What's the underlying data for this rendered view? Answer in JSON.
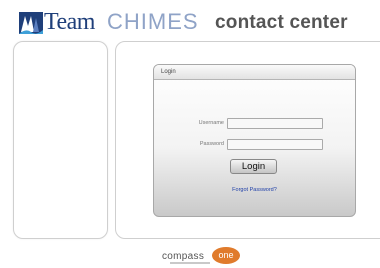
{
  "header": {
    "brand_team": "Team",
    "brand_chimes": "CHIMES",
    "brand_contact": "contact center"
  },
  "login": {
    "title": "Login",
    "username_label": "Username",
    "password_label": "Password",
    "username_value": "",
    "password_value": "",
    "button_label": "Login",
    "forgot_link": "Forgot Password?"
  },
  "footer": {
    "compass": "compass",
    "one": "one"
  },
  "colors": {
    "brand_blue": "#1f3f7a",
    "chimes_light_blue": "#8fa3c7",
    "accent_orange": "#e07b2c",
    "link_blue": "#1f3fa8"
  }
}
